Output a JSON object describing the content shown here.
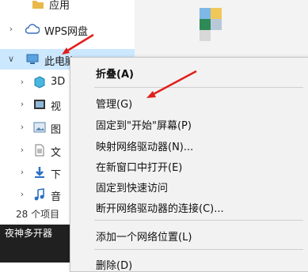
{
  "tree": {
    "items": [
      {
        "label": "应用",
        "icon": "folder-icon"
      },
      {
        "label": "WPS网盘",
        "icon": "cloud-icon"
      },
      {
        "label": "此电脑",
        "icon": "computer-icon"
      },
      {
        "label": "3D",
        "icon": "3d-objects-icon"
      },
      {
        "label": "视",
        "icon": "video-icon"
      },
      {
        "label": "图",
        "icon": "picture-icon"
      },
      {
        "label": "文",
        "icon": "document-icon"
      },
      {
        "label": "下",
        "icon": "download-icon"
      },
      {
        "label": "音",
        "icon": "music-icon"
      }
    ]
  },
  "status": {
    "text": "28 个项目"
  },
  "taskbar": {
    "label": "夜神多开器"
  },
  "context_menu": {
    "items": [
      {
        "label": "折叠(A)",
        "bold": true
      },
      {
        "label": "管理(G)"
      },
      {
        "label": "固定到\"开始\"屏幕(P)"
      },
      {
        "label": "映射网络驱动器(N)..."
      },
      {
        "label": "在新窗口中打开(E)"
      },
      {
        "label": "固定到快速访问"
      },
      {
        "label": "断开网络驱动器的连接(C)..."
      },
      {
        "label": "添加一个网络位置(L)"
      },
      {
        "label": "删除(D)"
      }
    ]
  },
  "colors": {
    "selection": "#cce8ff",
    "annotation_arrow": "#e0201c",
    "menu_bg": "#f2f2f2",
    "taskbar": "#202020"
  }
}
